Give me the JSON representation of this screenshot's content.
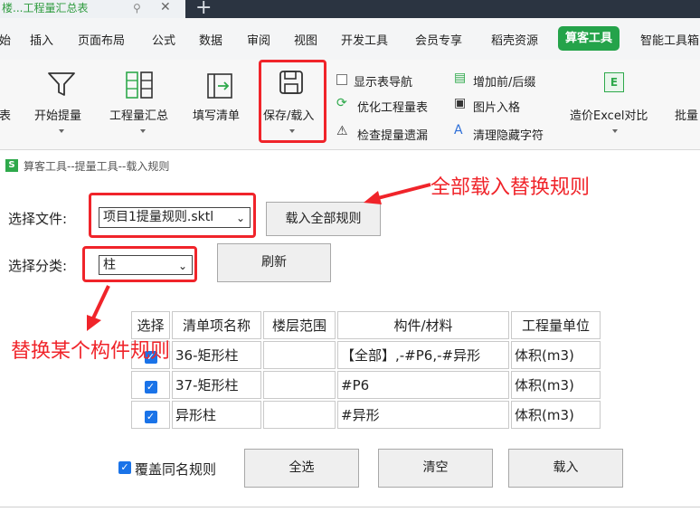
{
  "window": {
    "doc_tab": "楼...工程量汇总表"
  },
  "menu": {
    "items": [
      "始",
      "插入",
      "页面布局",
      "公式",
      "数据",
      "审阅",
      "视图",
      "开发工具",
      "会员专享",
      "稻壳资源"
    ],
    "active": "算客工具",
    "after": "智能工具箱"
  },
  "ribbon": {
    "cut_left": "表",
    "start_extract": "开始提量",
    "summary": "工程量汇总",
    "fill_list": "填写清单",
    "save_load": "保存/载入",
    "col1": [
      "显示表导航",
      "优化工程量表",
      "检查提量遗漏"
    ],
    "col2": [
      "增加前/后缀",
      "图片入格",
      "清理隐藏字符"
    ],
    "excel_compare": "造价Excel对比",
    "batch": "批量"
  },
  "dialog": {
    "title": "算客工具--提量工具--载入规则",
    "file_label": "选择文件:",
    "file_value": "项目1提量规则.sktl",
    "load_all_button": "载入全部规则",
    "category_label": "选择分类:",
    "category_value": "柱",
    "refresh_button": "刷新",
    "table": {
      "headers": [
        "选择",
        "清单项名称",
        "楼层范围",
        "构件/材料",
        "工程量单位"
      ],
      "rows": [
        {
          "checked": true,
          "name": "36-矩形柱",
          "floor": "",
          "component": "【全部】,-#P6,-#异形",
          "unit": "体积(m3)"
        },
        {
          "checked": true,
          "name": "37-矩形柱",
          "floor": "",
          "component": "#P6",
          "unit": "体积(m3)"
        },
        {
          "checked": true,
          "name": "异形柱",
          "floor": "",
          "component": "#异形",
          "unit": "体积(m3)"
        }
      ]
    },
    "override_label": "覆盖同名规则",
    "select_all_button": "全选",
    "clear_button": "清空",
    "load_button": "载入"
  },
  "annotations": {
    "load_all": "全部载入替换规则",
    "replace_one": "替换某个构件规则"
  },
  "colors": {
    "accent_red": "#f0242a",
    "active_green": "#24a34a",
    "checkbox_blue": "#1a73e8"
  }
}
